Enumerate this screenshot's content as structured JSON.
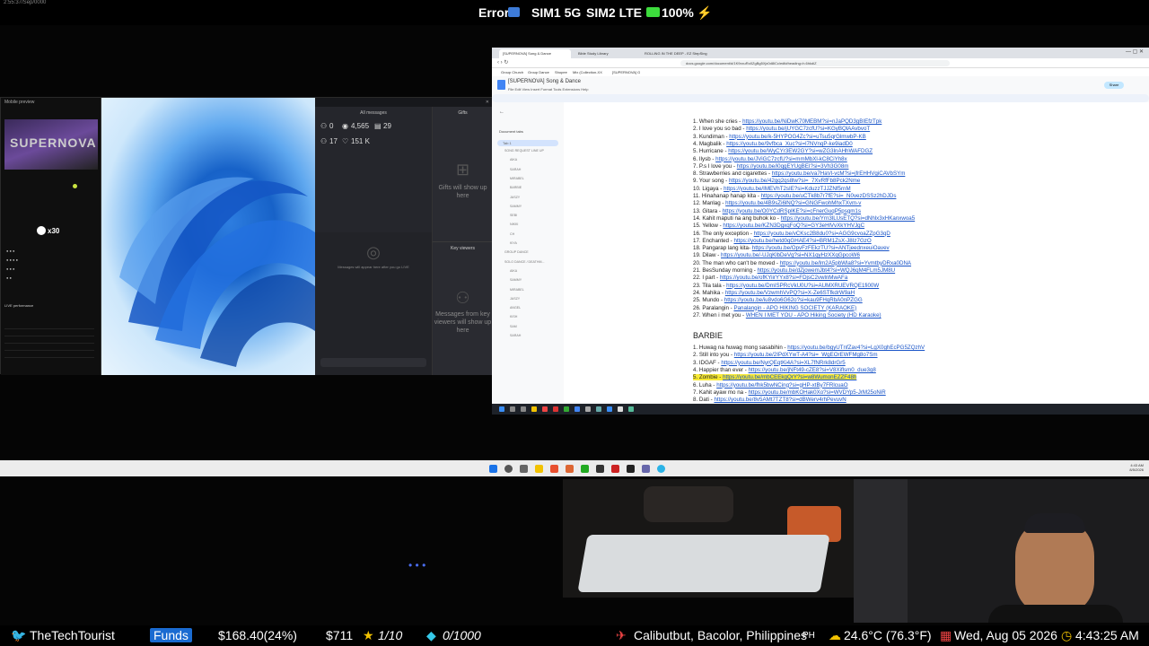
{
  "status_bar": {
    "tiny_text": "2:55:37/Sep/0000",
    "error": "Error",
    "sim1": "SIM1 5G",
    "sim2": "SIM2 LTE",
    "battery": "100%"
  },
  "stream_panel": {
    "mobile_preview_title": "Mobile preview",
    "banner_text": "SUPERNOVA",
    "viewer_count": "x30",
    "live_performance": "LIVE performance",
    "dashboard": {
      "title": "All messages",
      "stats_icons": [
        "person-icon",
        "eye-icon",
        "gift-icon",
        "person-add-icon",
        "heart-icon"
      ],
      "likes": "0",
      "views": "4,565",
      "gifts_count": "29",
      "followers": "17",
      "hearts": "151 K",
      "messages_empty": "Messages will appear here after you go LIVE",
      "gifts_title": "Gifts",
      "gifts_empty": "Gifts will show up here",
      "key_viewers_title": "Key viewers",
      "key_viewers_empty": "Messages from key viewers will show up here"
    }
  },
  "browser": {
    "tabs": [
      "[SUPERNOVA] Song & Dance",
      "Bible Study Library",
      "ROLLING IN THE DEEP - EZ StepSing"
    ],
    "url": "docs.google.com/document/d/1K9xxuRo0ZgBg5Xjx0d8iCc/edit#heading=h.6hkdiZ",
    "bookmarks": [
      "Group Church",
      "Group Dance",
      "Shopee",
      "Mix (Collection-XX",
      "[SUPERNOVA] G"
    ],
    "doc_title": "[SUPERNOVA] Song & Dance",
    "doc_menu": "File  Edit  View  Insert  Format  Tools  Extensions  Help",
    "share_label": "Share",
    "outline": {
      "title": "Document tabs",
      "tab": "Tab 1",
      "items": [
        "SONG REQUEST LINE UP",
        "AIKA",
        "SARAH",
        "MIRABEL",
        "BARBIE",
        "JASZY",
        "SAMMY",
        "SEBI",
        "NIKKI",
        "CH",
        "KIYA",
        "GROUP DANCE",
        "SOLO DANCE / DEATHM...",
        "AIKA",
        "SAMMY",
        "MIRABEL",
        "JASZY",
        "ANGEL",
        "KISH",
        "SAM",
        "SARAH"
      ]
    },
    "songs": [
      {
        "n": "1.",
        "t": "When she cries -",
        "u": "https://youtu.be/NiDwK70MEBM?si=nJaPQD3gBIEfzTpk"
      },
      {
        "n": "2.",
        "t": "I love you so bad -",
        "u": "https://youtu.be/jUYGC7zcfU?si=KGyBQlAAvbvoT"
      },
      {
        "n": "3.",
        "t": "Kundiman -",
        "u": "https://youtu.be/k-5HYPOG4Zc?si=uTsu5qrGlmwbP-KB"
      },
      {
        "n": "4.",
        "t": "Magbalik -",
        "u": "https://youtu.be/9vfbca_Xuc?si=l7NVnqP-ke9iadD0"
      },
      {
        "n": "5.",
        "t": "Hurricane -",
        "u": "https://youtu.be/WyCYr3EW2GY?si=wZG3lnAHhWAFDGZ"
      },
      {
        "n": "6.",
        "t": "Ilysb -",
        "u": "https://youtu.be/JViGC7zcfU?si=mmMbXl-kC8CiYh8x"
      },
      {
        "n": "7.",
        "t": "P.s I love you -",
        "u": "https://youtu.be/i0qgEYUgBEI?si=3Vh3G08m"
      },
      {
        "n": "8.",
        "t": "Strawberries and cigarettes -",
        "u": "https://youtu.be/va7HaVl-vcM?si=jfrEHHVgiCAVbSYm"
      },
      {
        "n": "9.",
        "t": "Your song -",
        "u": "https://youtu.be/42gq2qs8lw?si=_7XvRfFb8Pck2Nme"
      },
      {
        "n": "10.",
        "t": "Ligaya -",
        "u": "https://youtu.be/IMEVhT2sIE?si=KduzzTJJZNf5rnM"
      },
      {
        "n": "11.",
        "t": "Hinahanap hanap kita -",
        "u": "https://youtu.be/uCTk8b7r7fE?si=_N0vezDSSz2hDJDs"
      },
      {
        "n": "12.",
        "t": "Manlag -",
        "u": "https://youtu.be/4B9sZi6lNQ?si=GNGFwohMhxTXvm-v"
      },
      {
        "n": "13.",
        "t": "Gitara -",
        "u": "https://youtu.be/O0YCdRSplKE?si=cFnerGuqP5psgm1s"
      },
      {
        "n": "14.",
        "t": "Kahit maputi na ang buhok ko -",
        "u": "https://youtu.be/Yrn3lLUsETQ?si=dNhlx3xHKanxwoa5"
      },
      {
        "n": "15.",
        "t": "Yellow -",
        "u": "https://youtu.be/KZN3DgxqFoQ?si=GY3eHlVvXkYHVJgC"
      },
      {
        "n": "16.",
        "t": "The only exception -",
        "u": "https://youtu.be/vCKsc2B8du0?si=AGG9cvoaZZpG3qD"
      },
      {
        "n": "17.",
        "t": "Enchanted -",
        "u": "https://youtu.be/hetd0qGHAE4?si=BRM1ZsX-J8Iz7GzO"
      },
      {
        "n": "18.",
        "t": "Pangarap lang kita-",
        "u": "https://youtu.be/OpvFzFEkzTU?si=ANTjeednxeuiOavev"
      },
      {
        "n": "19.",
        "t": "Dilaw -",
        "u": "https://youtu.be/-UJqKlbDeVg?si=NX1qyHzXXqGpcoW6"
      },
      {
        "n": "20.",
        "t": "The man who can't be moved -",
        "u": "https://youtu.be/lm2A5pbWla8?si=YvmtbyDRxa0DNA"
      },
      {
        "n": "21.",
        "t": "BesSunday morning -",
        "u": "https://youtu.be/dZjowemJbt4?si=WQJ6qM4FLm5JM8U"
      },
      {
        "n": "22.",
        "t": "I part -",
        "u": "https://youtu.be/ofKYiirYYx8?si=FDjsC2vwlnMwAFa"
      },
      {
        "n": "23.",
        "t": "Tila tala -",
        "u": "https://youtu.be/DmISPRcVkU0U?si=AUMXRUEVRQE1fi00W"
      },
      {
        "n": "24.",
        "t": "Mahika -",
        "u": "https://youtu.be/VzwmhVvPQ?si=X-Ze6STfkdrW9aH"
      },
      {
        "n": "25.",
        "t": "Mundo -",
        "u": "https://youtu.be/iu8vdo6G62o?si=kau9FHqRbA0nPZGG"
      },
      {
        "n": "26.",
        "t": "Paralangin -",
        "u": "Panalangin - APO HIKING SOCIETY (KARAOKE)"
      },
      {
        "n": "27.",
        "t": "When i met you -",
        "u": "WHEN I MET YOU - APO Hiking Society (HD Karaoke)"
      }
    ],
    "barbie_heading": "BARBIE",
    "barbie_songs": [
      {
        "n": "1.",
        "t": "Huwag na huwag mong sasabihin -",
        "u": "https://youtu.be/bgyUTnfZav4?si=LgX0ghEcPG5ZQzhV",
        "hl": false
      },
      {
        "n": "2.",
        "t": "Still into you -",
        "u": "https://youtu.be/2IPdXYwT-A4?si=_WgEOrEWFMg8o7Sm",
        "hl": false
      },
      {
        "n": "3.",
        "t": "IDGAF -",
        "u": "https://youtu.be/NyrQEqtKi4A?si=XL7fNRrk8drGr5",
        "hl": false
      },
      {
        "n": "4.",
        "t": "Happier than ever -",
        "u": "https://youtu.be/jNFt49-cZE8?si=V8Xiflsm0_due3g8",
        "hl": false
      },
      {
        "n": "5.",
        "t": "Zombie -",
        "u": "https://youtu.be/mbCEEkgQrY?si=w8WumonEZZF48h",
        "hl": true
      },
      {
        "n": "6.",
        "t": "Luha -",
        "u": "https://youtu.be/fhk5bwNCing?si=gHP-xtBy7FRlcuaO",
        "hl": false
      },
      {
        "n": "7.",
        "t": "Kahit ayaw mo na -",
        "u": "https://youtu.be/mbKOHak0Xo?si=WVDYp5-JrM25oNiR",
        "hl": false
      },
      {
        "n": "8.",
        "t": "Dati -",
        "u": "https://youtu.be/8v5AMt7TZT8?si=dBWerv4rhPevuvN",
        "hl": false
      }
    ]
  },
  "taskbar": {
    "time": "4:43 AM",
    "date": "8/5/2026"
  },
  "ticker": {
    "channel": "TheTechTourist",
    "funds_label": "Funds",
    "funds_value": "$168.40(24%)",
    "amount": "$711",
    "star_value": "1/10",
    "gem_value": "0/1000",
    "location": "Calibutbut, Bacolor, Philippines",
    "location_code": "PH",
    "weather": "24.6°C (76.3°F)",
    "date": "Wed, Aug 05 2026",
    "time": "4:43:25 AM"
  },
  "colors": {
    "link": "#1a55c8",
    "highlight": "#f7e934",
    "funds_bg": "#1a6bd1",
    "battery": "#3ddc3d"
  }
}
